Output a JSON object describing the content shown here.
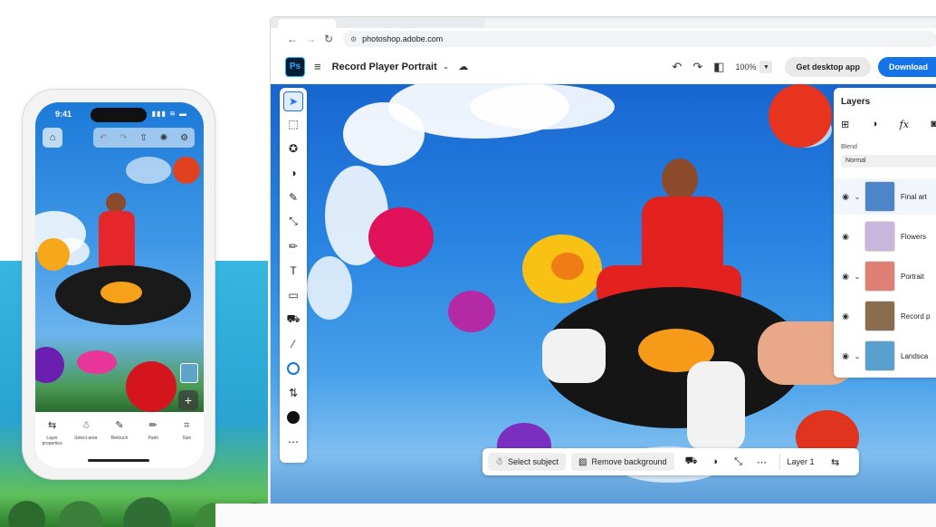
{
  "phone": {
    "time": "9:41",
    "status": "▮▮▮ ≋ ▬",
    "tools": [
      {
        "icon": "⇆",
        "label": "Layer properties"
      },
      {
        "icon": "☃",
        "label": "Select area"
      },
      {
        "icon": "✎",
        "label": "Retouch"
      },
      {
        "icon": "✏",
        "label": "Paint"
      },
      {
        "icon": "⌗",
        "label": "Size"
      }
    ]
  },
  "browser": {
    "url": "photoshop.adobe.com"
  },
  "app": {
    "logo": "Ps",
    "document_title": "Record Player Portrait",
    "zoom": "100%",
    "get_desktop_label": "Get desktop app",
    "download_label": "Download"
  },
  "layers_panel": {
    "title": "Layers",
    "blend_label": "Blend",
    "blend_value": "Normal",
    "layers": [
      {
        "name": "Final art",
        "thumb": "#4c86c9",
        "selected": true
      },
      {
        "name": "Flowers",
        "thumb": "#c9b6dd",
        "selected": false
      },
      {
        "name": "Portrait",
        "thumb": "#e07f74",
        "selected": false
      },
      {
        "name": "Record p",
        "thumb": "#8a6d4f",
        "selected": false
      },
      {
        "name": "Landsca",
        "thumb": "#5aa0cf",
        "selected": false
      }
    ]
  },
  "bottom_bar": {
    "select_subject": "Select subject",
    "remove_background": "Remove background",
    "layer_label": "Layer 1"
  },
  "colors": {
    "accent": "#1473e6",
    "ps_bg": "#001e36",
    "ps_fg": "#31a8ff"
  }
}
